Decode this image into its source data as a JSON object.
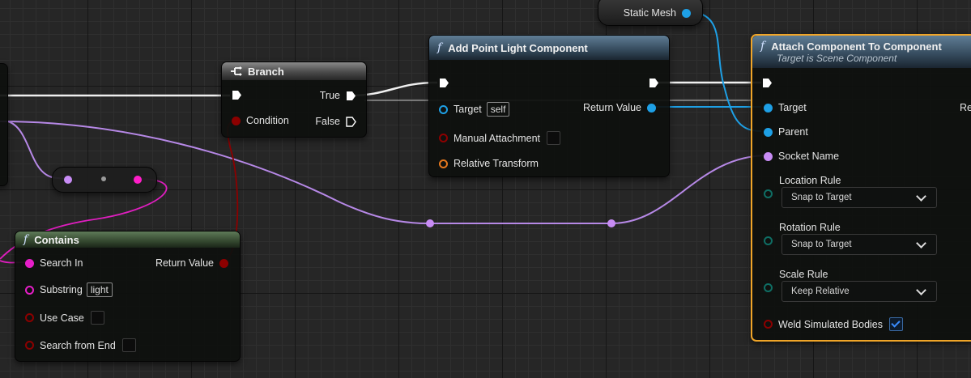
{
  "nodes": {
    "static_mesh": {
      "pin_label": "Static Mesh"
    },
    "branch": {
      "title": "Branch",
      "true_label": "True",
      "false_label": "False",
      "condition_label": "Condition"
    },
    "add_point_light": {
      "title": "Add Point Light Component",
      "target_label": "Target",
      "target_value": "self",
      "return_label": "Return Value",
      "manual_attachment_label": "Manual Attachment",
      "relative_transform_label": "Relative Transform"
    },
    "attach_component": {
      "title": "Attach Component To Component",
      "subtitle": "Target is Scene Component",
      "target_label": "Target",
      "return_label_partial": "Re",
      "parent_label": "Parent",
      "socket_name_label": "Socket Name",
      "location_rule_label": "Location Rule",
      "location_rule_value": "Snap to Target",
      "rotation_rule_label": "Rotation Rule",
      "rotation_rule_value": "Snap to Target",
      "scale_rule_label": "Scale Rule",
      "scale_rule_value": "Keep Relative",
      "weld_label": "Weld Simulated Bodies",
      "weld_checked": true
    },
    "contains": {
      "title": "Contains",
      "search_in_label": "Search In",
      "return_label": "Return Value",
      "substring_label": "Substring",
      "substring_value": "light",
      "use_case_label": "Use Case",
      "search_from_end_label": "Search from End"
    }
  },
  "icons": {
    "function": "f",
    "branch": "branch-icon"
  },
  "colors": {
    "exec": "#ffffff",
    "object_pin": "#1ea0e6",
    "string_pin": "#e61ec8",
    "name_pin": "#c88cf5",
    "bool_pin": "#8c0000",
    "struct_pin": "#e6781e",
    "enum_pin": "#0f6e64",
    "selection": "#f0a528"
  }
}
